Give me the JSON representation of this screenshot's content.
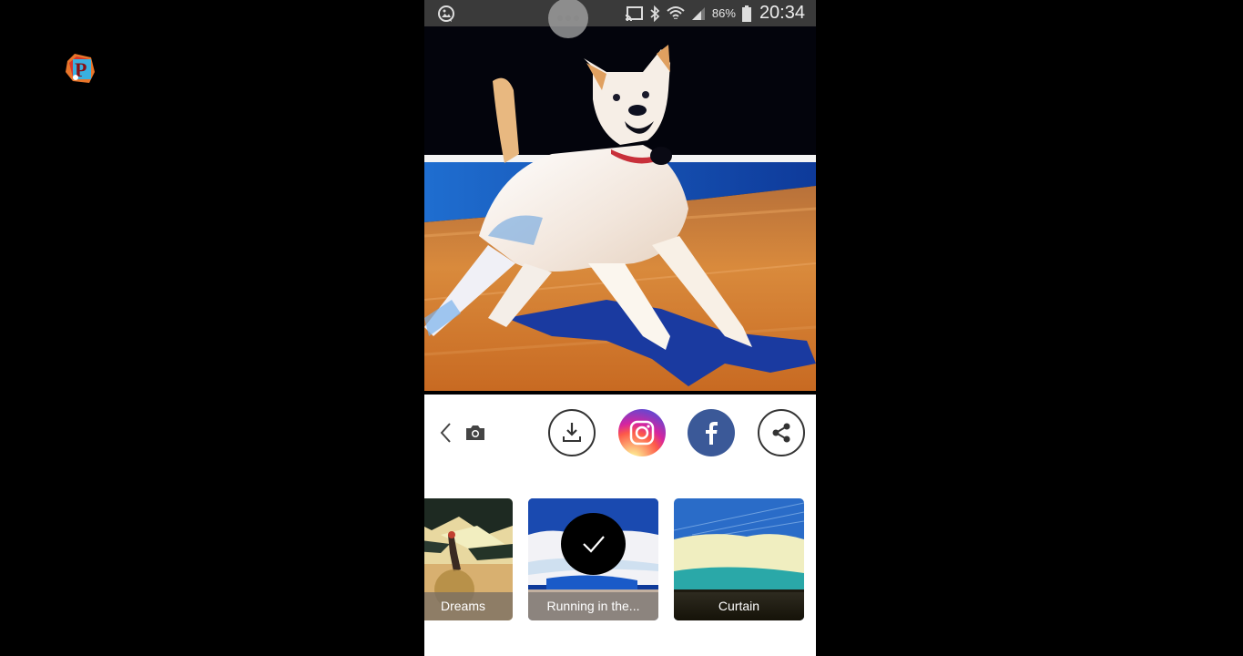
{
  "overlay": {
    "logo_letter": "P",
    "logo_icon": "channel-logo-icon"
  },
  "statusbar": {
    "left_icon": "gallery-notification-icon",
    "bubble_icon": "more-dots-icon",
    "icons": [
      "screen-cast-icon",
      "bluetooth-icon",
      "wifi-icon",
      "signal-icon"
    ],
    "battery_percent": "86%",
    "battery_icon": "battery-icon",
    "time": "20:34"
  },
  "photo": {
    "description": "Stylized painting of a white dog running on a beach",
    "colors": {
      "sky": "#03040c",
      "sea": "#1e63c8",
      "sand": "#d27f32",
      "shadow": "#1a3a9a",
      "dog": "#f4ece4"
    }
  },
  "toolbar": {
    "back_icon": "chevron-left-icon",
    "camera_icon": "camera-icon",
    "buttons": [
      {
        "name": "download",
        "icon": "download-icon"
      },
      {
        "name": "instagram",
        "icon": "instagram-icon"
      },
      {
        "name": "facebook",
        "icon": "facebook-icon",
        "glyph": "f",
        "color": "#3b5998"
      },
      {
        "name": "share",
        "icon": "share-icon"
      }
    ]
  },
  "styles": [
    {
      "label": "Dreams",
      "selected": false
    },
    {
      "label": "Running in the...",
      "selected": true
    },
    {
      "label": "Curtain",
      "selected": false
    }
  ],
  "selected_icon": "checkmark-icon"
}
